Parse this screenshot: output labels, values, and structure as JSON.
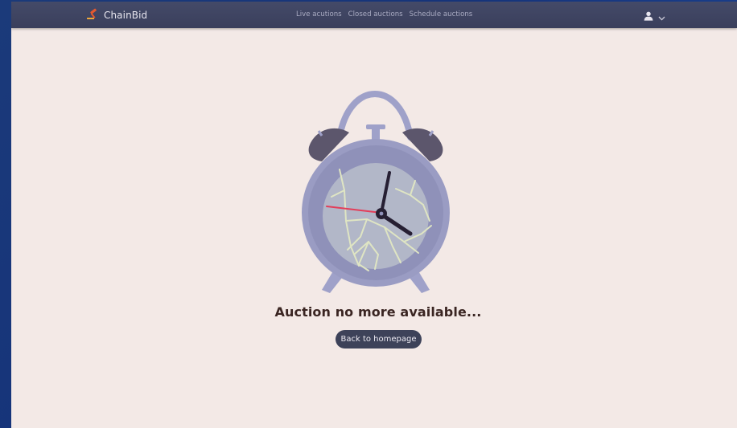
{
  "header": {
    "brand_name": "ChainBid",
    "brand_icon": "gavel-icon",
    "nav": [
      {
        "label": "Live acutions"
      },
      {
        "label": "Closed auctions"
      },
      {
        "label": "Schedule auctions"
      }
    ],
    "user_icon": "user-icon",
    "dropdown_icon": "chevron-down-icon"
  },
  "main": {
    "illustration_icon": "broken-alarm-clock-icon",
    "message": "Auction no more available...",
    "back_button_label": "Back to homepage"
  },
  "colors": {
    "navbar": "#3f4462",
    "page_background": "#f3e9e6",
    "button": "#3d4259",
    "brand_accent": "#e4592f"
  }
}
